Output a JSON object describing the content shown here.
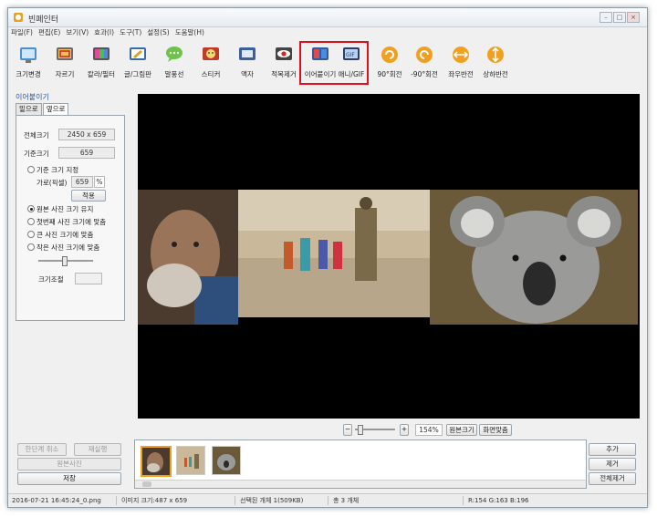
{
  "window": {
    "title": "빈페인터"
  },
  "menu": [
    "파일(F)",
    "편집(E)",
    "보기(V)",
    "효과(I)",
    "도구(T)",
    "설정(S)",
    "도움말(H)"
  ],
  "toolbar": [
    {
      "label": "크기변경",
      "icon": "resize-icon"
    },
    {
      "label": "자르기",
      "icon": "crop-icon"
    },
    {
      "label": "칼라/필터",
      "icon": "color-filter-icon"
    },
    {
      "label": "글/그림판",
      "icon": "text-draw-icon"
    },
    {
      "label": "말풍선",
      "icon": "speech-bubble-icon"
    },
    {
      "label": "스티커",
      "icon": "sticker-icon"
    },
    {
      "label": "액자",
      "icon": "frame-icon"
    },
    {
      "label": "적목제거",
      "icon": "red-eye-icon"
    },
    {
      "label": "이어붙이기",
      "icon": "merge-icon"
    },
    {
      "label": "애니/GIF",
      "icon": "gif-icon"
    },
    {
      "label": "90°회전",
      "icon": "rotate-cw-icon"
    },
    {
      "label": "-90°회전",
      "icon": "rotate-ccw-icon"
    },
    {
      "label": "좌우반전",
      "icon": "flip-h-icon"
    },
    {
      "label": "상하반전",
      "icon": "flip-v-icon"
    }
  ],
  "panel": {
    "title": "이어붙이기",
    "tabs": [
      "밑으로",
      "옆으로"
    ],
    "active_tab": 1,
    "total_size_label": "전체크기",
    "total_size_value": "2450 x 659",
    "base_size_label": "기준크기",
    "base_size_value": "659",
    "opt_base_size": "기준 크기 지정",
    "width_px_label": "가로(픽셀)",
    "width_px_value": "659",
    "percent_label": "%",
    "apply_label": "적용",
    "options": [
      "원본 사진 크기 유지",
      "첫번째 사진 크기에 맞춤",
      "큰 사진 크기에 맞춤",
      "작은 사진 크기에 맞춤"
    ],
    "selected_option": 0,
    "size_adjust_label": "크기조절"
  },
  "zoom": {
    "minus": "−",
    "plus": "+",
    "value": "154%",
    "original_label": "원본크기",
    "fit_label": "화면맞춤",
    "slider_level": 0.1
  },
  "left_buttons": {
    "undo": "한단계 취소",
    "redo": "재실행",
    "original": "원본사진",
    "save": "저장"
  },
  "right_buttons": {
    "add": "추가",
    "remove": "제거",
    "remove_all": "전체제거"
  },
  "status": {
    "file": "2016-07-21 16:45:24_0.png",
    "image_size": "이미지 크기:487 x 659",
    "selected": "선택된 개체 1(509KB)",
    "total": "총 3 개체",
    "rgb": "R:154 G:163 B:196"
  },
  "colors": {
    "highlight": "#e0101a",
    "canvas": "#000000",
    "accent_title": "#2a5aa8"
  }
}
